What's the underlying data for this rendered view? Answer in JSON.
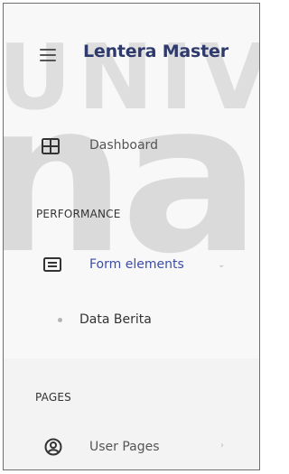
{
  "app": {
    "title": "Lentera Master"
  },
  "watermark": {
    "line1": "UNIVERS",
    "line2": "nar"
  },
  "sidebar": {
    "dashboard": {
      "label": "Dashboard",
      "icon": "grid-icon"
    },
    "sections": [
      {
        "title": "PERFORMANCE",
        "items": [
          {
            "label": "Form elements",
            "icon": "form-icon",
            "expanded": true,
            "subitems": [
              {
                "label": "Data Berita"
              }
            ]
          }
        ]
      },
      {
        "title": "PAGES",
        "items": [
          {
            "label": "User Pages",
            "icon": "user-circle-icon",
            "expanded": false
          }
        ]
      }
    ]
  },
  "colors": {
    "brand": "#2e3a6b",
    "active_item": "#3b4ea8",
    "background": "#f8f8f8"
  }
}
